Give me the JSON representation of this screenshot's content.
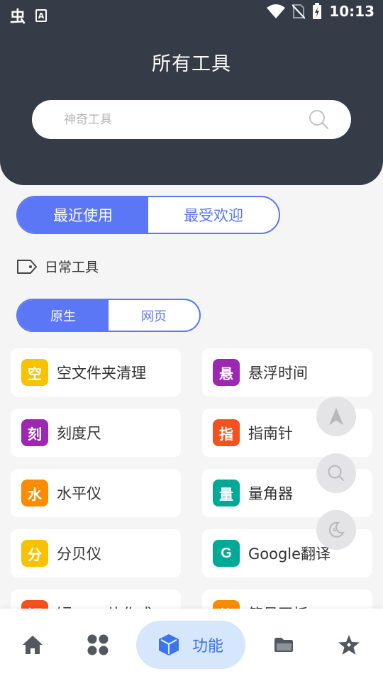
{
  "status_bar": {
    "app_glyph": "虫",
    "notify_glyph": "A",
    "time": "10:13"
  },
  "header": {
    "title": "所有工具"
  },
  "search": {
    "placeholder": "神奇工具"
  },
  "main_tabs": [
    {
      "label": "最近使用",
      "active": true
    },
    {
      "label": "最受欢迎",
      "active": false
    }
  ],
  "category": {
    "label": "日常工具"
  },
  "sub_tabs": [
    {
      "label": "原生",
      "active": true
    },
    {
      "label": "网页",
      "active": false
    }
  ],
  "tools": [
    {
      "badge": "空",
      "label": "空文件夹清理",
      "color": "#f7c200"
    },
    {
      "badge": "悬",
      "label": "悬浮时间",
      "color": "#9c27b0"
    },
    {
      "badge": "刻",
      "label": "刻度尺",
      "color": "#9c27b0"
    },
    {
      "badge": "指",
      "label": "指南针",
      "color": "#f4511e"
    },
    {
      "badge": "水",
      "label": "水平仪",
      "color": "#fb8c00"
    },
    {
      "badge": "量",
      "label": "量角器",
      "color": "#00a896"
    },
    {
      "badge": "分",
      "label": "分贝仪",
      "color": "#f7c200"
    },
    {
      "badge": "G",
      "label": "Google翻译",
      "color": "#00a896"
    },
    {
      "badge": "短",
      "label": "短once片作式",
      "color": "#f4511e"
    },
    {
      "badge": "简",
      "label": "简易画板",
      "color": "#fb8c00"
    }
  ],
  "bottom_nav": {
    "items": [
      "home-icon",
      "apps-icon",
      "function-icon",
      "folder-icon",
      "star-icon"
    ],
    "active_label": "功能"
  },
  "colors": {
    "header_bg": "#353b47",
    "accent": "#5b77f5",
    "nav_active_bg": "#d6e6fb",
    "nav_active_fg": "#3d74e8"
  }
}
